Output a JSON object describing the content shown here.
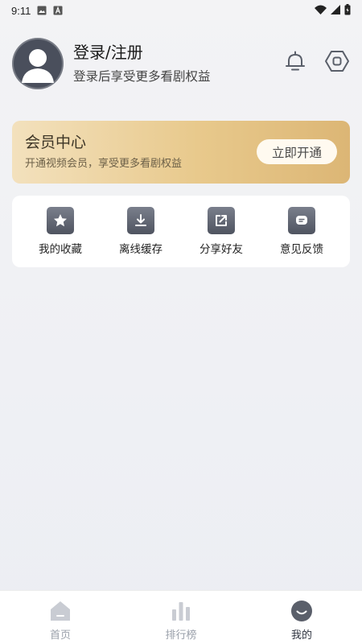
{
  "status_bar": {
    "time": "9:11",
    "left_icons": [
      "image-icon",
      "a-box-icon"
    ],
    "right_icons": [
      "wifi-icon",
      "signal-icon",
      "battery-icon"
    ]
  },
  "profile": {
    "title": "登录/注册",
    "subtitle": "登录后享受更多看剧权益",
    "icons": [
      "bell-icon",
      "settings-hexagon-icon"
    ]
  },
  "vip": {
    "title": "会员中心",
    "subtitle": "开通视频会员，享受更多看剧权益",
    "button_label": "立即开通",
    "colors": {
      "start": "#f3e1bd",
      "end": "#dcb675"
    }
  },
  "functions": [
    {
      "label": "我的收藏",
      "icon": "star-icon"
    },
    {
      "label": "离线缓存",
      "icon": "download-icon"
    },
    {
      "label": "分享好友",
      "icon": "share-icon"
    },
    {
      "label": "意见反馈",
      "icon": "feedback-icon"
    }
  ],
  "bottom_nav": {
    "items": [
      {
        "label": "首页",
        "icon": "home-icon",
        "active": false
      },
      {
        "label": "排行榜",
        "icon": "ranking-icon",
        "active": false
      },
      {
        "label": "我的",
        "icon": "profile-icon",
        "active": true
      }
    ],
    "colors": {
      "active": "#2f3440",
      "inactive": "#9aa0aa"
    }
  }
}
